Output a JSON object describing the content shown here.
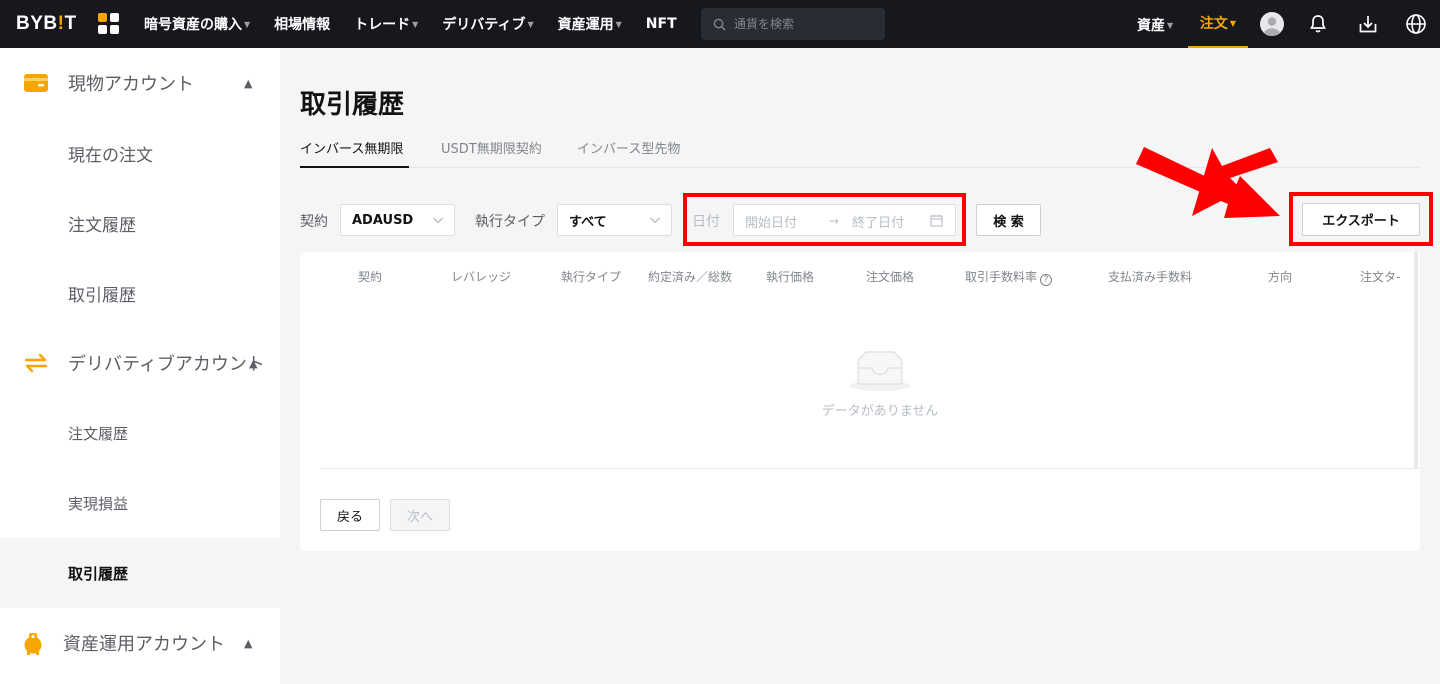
{
  "topnav": {
    "logo": {
      "main": "BYB",
      "bang": "!",
      "tail": "T"
    },
    "menu": [
      {
        "label": "暗号資産の購入",
        "caret": true
      },
      {
        "label": "相場情報",
        "caret": false
      },
      {
        "label": "トレード",
        "caret": true
      },
      {
        "label": "デリバティブ",
        "caret": true
      },
      {
        "label": "資産運用",
        "caret": true
      },
      {
        "label": "NFT",
        "caret": false
      }
    ],
    "search_placeholder": "通貨を検索",
    "assets_label": "資産",
    "orders_label": "注文",
    "accent_color": "#f7a600",
    "icons": [
      "avatar-icon",
      "bell-icon",
      "download-icon",
      "globe-icon"
    ]
  },
  "sidebar": {
    "spot_account": "現物アカウント",
    "spot_items": [
      "現在の注文",
      "注文履歴",
      "取引履歴"
    ],
    "derivatives_account": "デリバティブアカウント",
    "derivatives_items": [
      "注文履歴",
      "実現損益",
      "取引履歴"
    ],
    "derivatives_active": "取引履歴",
    "earn_account": "資産運用アカウント"
  },
  "main": {
    "title": "取引履歴",
    "tabs": [
      "インバース無期限",
      "USDT無期限契約",
      "インバース型先物"
    ],
    "active_tab": "インバース無期限",
    "filters": {
      "contract_label": "契約",
      "contract_value": "ADAUSD",
      "exec_type_label": "執行タイプ",
      "exec_type_value": "すべて",
      "date_label": "日付",
      "start_placeholder": "開始日付",
      "end_placeholder": "終了日付",
      "search_button": "検 索",
      "export_button": "エクスポート"
    },
    "table": {
      "columns": [
        "契約",
        "レバレッジ",
        "執行タイプ",
        "約定済み／総数",
        "執行価格",
        "注文価格",
        "取引手数料率",
        "支払済み手数料",
        "方向",
        "注文タ-"
      ],
      "rows": [],
      "empty_text": "データがありません"
    },
    "pagination": {
      "prev": "戻る",
      "next": "次へ"
    }
  },
  "annotation_color": "#ff0000"
}
